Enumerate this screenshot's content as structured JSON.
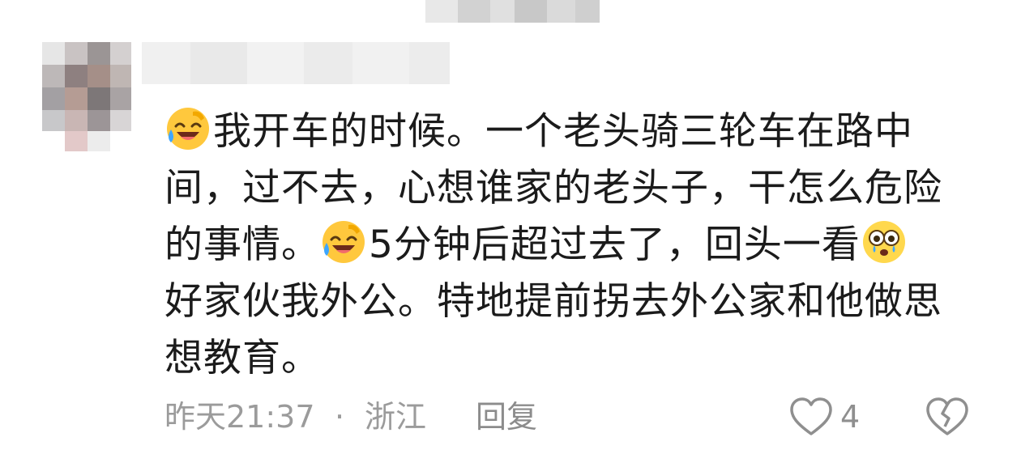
{
  "comment": {
    "lines": [
      "我开车的时候。一个老头骑三轮车在路中",
      "间，过不去，心想谁家的老头子，干怎么危险",
      "的事情。",
      "5分钟后超过去了，回头一看",
      "好家伙我外公。特地提前拐去外公家和他做思",
      "想教育。"
    ],
    "emojis": [
      "laughing-crying-emoji",
      "laughing-crying-emoji",
      "shocked-teary-emoji"
    ]
  },
  "footer": {
    "time": "昨天21:37",
    "separator": "·",
    "location": "浙江",
    "reply_label": "回复",
    "like_count": "4"
  },
  "colors": {
    "text": "#1b1b1b",
    "meta": "#9b9b9b",
    "emoji_face": "#ffc83d",
    "emoji_tear": "#3ea6ff"
  }
}
